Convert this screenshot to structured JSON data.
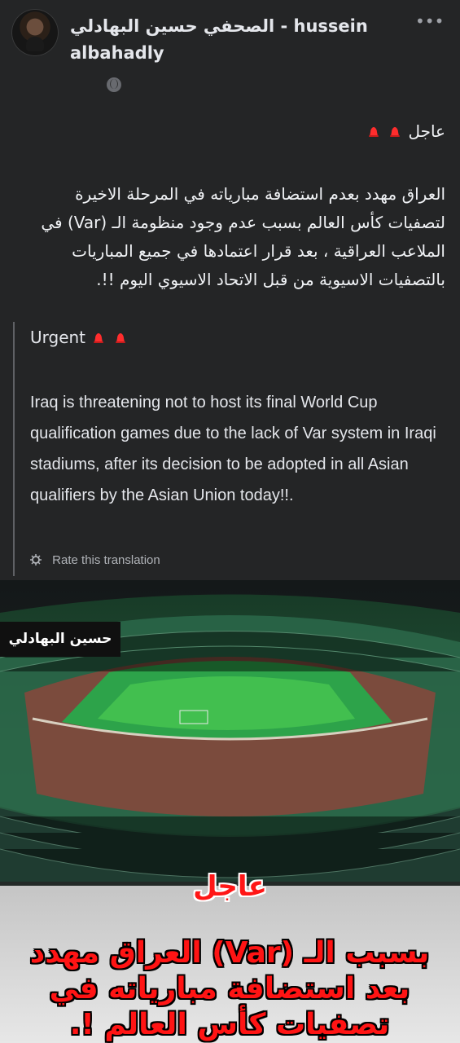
{
  "post": {
    "author": "الصحفي حسين البهادلي - hussein albahadly",
    "menu_icon": "more-horizontal-icon",
    "privacy_icon": "globe-icon",
    "urgent_label_ar": "عاجل",
    "body_ar": "العراق مهدد بعدم استضافة مبارياته في المرحلة الاخيرة لتصفيات كأس العالم بسبب عدم وجود منظومة الـ (Var) في الملاعب العراقية ، بعد قرار اعتمادها في جميع المباريات بالتصفيات الاسيوية من قبل الاتحاد الاسيوي اليوم !!.",
    "siren_icon": "siren-icon"
  },
  "translation": {
    "urgent_label": "Urgent",
    "text": "Iraq is threatening not to host its final World Cup qualification games due to the lack of Var system in Iraqi stadiums, after its decision to be adopted in all Asian qualifiers by the Asian Union today!!.",
    "rate_label": "Rate this translation",
    "gear_icon": "gear-icon"
  },
  "image": {
    "watermark": "حسين البهادلي",
    "title": "عاجل",
    "headline": "بسبب الـ (Var) العراق مهدد بعد استضافة مبارياته في تصفيات كأس العالم !."
  },
  "colors": {
    "background": "#242526",
    "text": "#e4e6eb",
    "muted": "#b0b3b8",
    "alert_red": "#ff1414"
  }
}
